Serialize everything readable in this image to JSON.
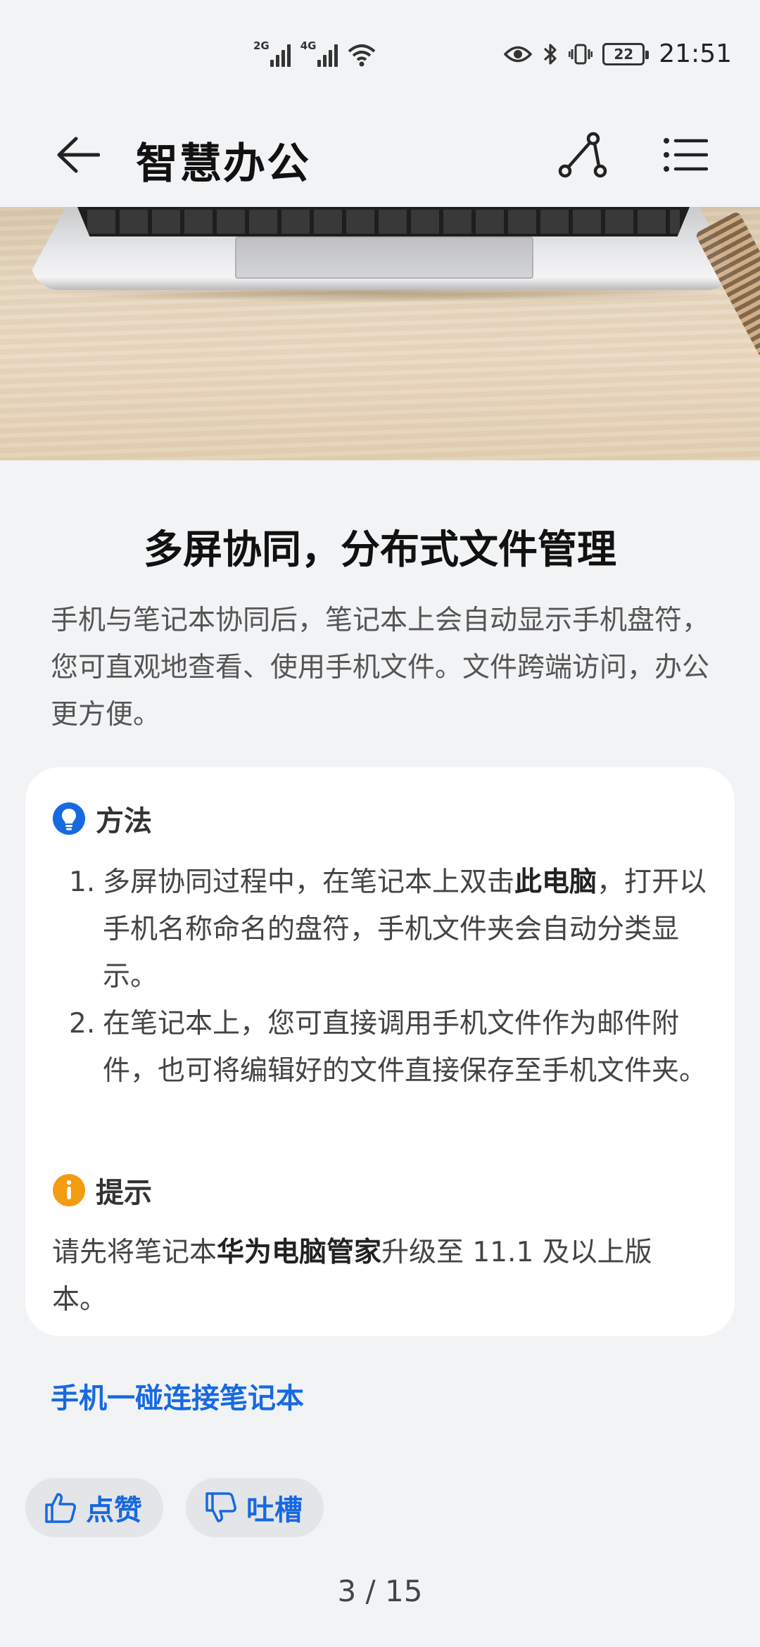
{
  "status_bar": {
    "net1_label": "2G",
    "net2_label": "4G",
    "battery_level": "22",
    "time": "21:51"
  },
  "app_bar": {
    "title": "智慧办公",
    "icons": [
      "back-arrow-icon",
      "share-branch-icon",
      "list-menu-icon"
    ]
  },
  "article": {
    "headline": "多屏协同，分布式文件管理",
    "description": "手机与笔记本协同后，笔记本上会自动显示手机盘符，您可直观地查看、使用手机文件。文件跨端访问，办公更方便。"
  },
  "method": {
    "heading": "方法",
    "icon": "lightbulb-icon",
    "icon_color": "#1769e0",
    "steps": [
      {
        "num": "1.",
        "before": "多屏协同过程中，在笔记本上双击",
        "bold": "此电脑",
        "after": "，打开以手机名称命名的盘符，手机文件夹会自动分类显示。"
      },
      {
        "num": "2.",
        "text": "在笔记本上，您可直接调用手机文件作为邮件附件，也可将编辑好的文件直接保存至手机文件夹。"
      }
    ]
  },
  "tip": {
    "heading": "提示",
    "icon": "info-icon",
    "icon_color": "#f39c12",
    "before": "请先将笔记本",
    "bold": "华为电脑管家",
    "after": "升级至 11.1 及以上版本。"
  },
  "related_link": "手机一碰连接笔记本",
  "feedback": {
    "like_label": "点赞",
    "dislike_label": "吐槽"
  },
  "pagination": "3 / 15",
  "accent_color": "#1769e0"
}
